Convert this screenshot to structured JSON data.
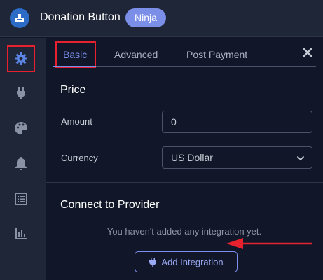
{
  "app": {
    "title": "Donation Button",
    "badge": "Ninja",
    "logo_icon": "donation-box-icon"
  },
  "sidebar": {
    "items": [
      {
        "name": "settings",
        "icon": "gear-icon",
        "active": true
      },
      {
        "name": "integrations",
        "icon": "plug-icon",
        "active": false
      },
      {
        "name": "appearance",
        "icon": "palette-icon",
        "active": false
      },
      {
        "name": "notifications",
        "icon": "bell-icon",
        "active": false
      },
      {
        "name": "form-entries",
        "icon": "list-icon",
        "active": false
      },
      {
        "name": "reports",
        "icon": "chart-icon",
        "active": false
      }
    ]
  },
  "tabs": [
    {
      "label": "Basic",
      "active": true
    },
    {
      "label": "Advanced",
      "active": false
    },
    {
      "label": "Post Payment",
      "active": false
    }
  ],
  "price": {
    "title": "Price",
    "amount_label": "Amount",
    "amount_value": "0",
    "currency_label": "Currency",
    "currency_value": "US Dollar"
  },
  "provider": {
    "title": "Connect to Provider",
    "empty_text": "You haven't added any integration yet.",
    "add_button_label": "Add Integration"
  },
  "colors": {
    "accent": "#7b8ff0",
    "highlight": "#e8212e",
    "background": "#111728",
    "panel": "#1f2638"
  }
}
